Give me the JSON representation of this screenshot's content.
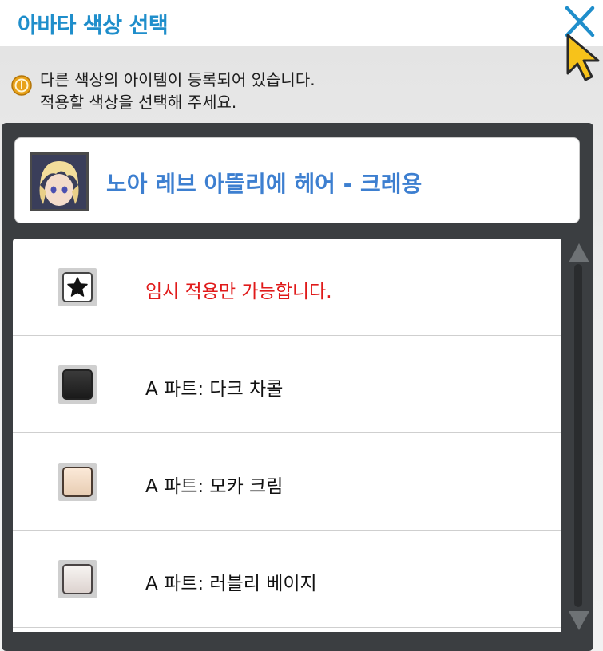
{
  "window": {
    "title": "아바타 색상 선택"
  },
  "notice": {
    "line1": "다른 색상의 아이템이 등록되어 있습니다.",
    "line2": "적용할 색상을 선택해 주세요.",
    "icon": "coin-icon"
  },
  "item": {
    "name": "노아 레브 아뜰리에 헤어 - 크레용",
    "thumbnail_icon": "hair-avatar-portrait"
  },
  "options": [
    {
      "label": "임시 적용만 가능합니다.",
      "icon": "star-icon",
      "color": "#ffffff",
      "warning": true
    },
    {
      "label": "A 파트: 다크 차콜",
      "icon": "color-swatch",
      "color": "#262626",
      "warning": false
    },
    {
      "label": "A 파트: 모카 크림",
      "icon": "color-swatch",
      "color": "#f3dcc7",
      "warning": false
    },
    {
      "label": "A 파트: 러블리 베이지",
      "icon": "color-swatch",
      "color": "#efe9e6",
      "warning": false
    }
  ],
  "colors": {
    "title": "#1f8ecb",
    "item_name": "#3d7fd0",
    "warning": "#e01a1a",
    "panel": "#3b3e41"
  }
}
